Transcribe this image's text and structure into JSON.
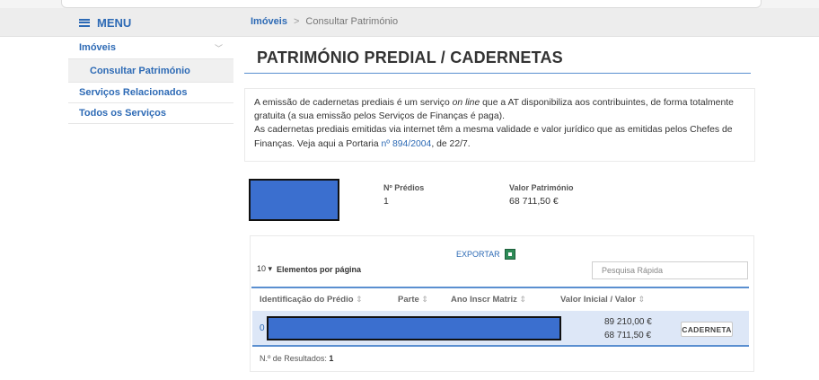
{
  "menu": {
    "label": "MENU",
    "icon": "hamburger-icon"
  },
  "breadcrumb": {
    "root": "Imóveis",
    "separator": ">",
    "current": "Consultar Património"
  },
  "sidebar": {
    "items": [
      {
        "label": "Imóveis",
        "expanded": true
      },
      {
        "label": "Consultar Património",
        "sub": true
      },
      {
        "label": "Serviços Relacionados"
      },
      {
        "label": "Todos os Serviços"
      }
    ]
  },
  "page": {
    "title": "PATRIMÓNIO PREDIAL / CADERNETAS"
  },
  "info": {
    "p1_a": "A emissão de cadernetas prediais é um serviço ",
    "p1_em": "on line",
    "p1_b": " que a AT disponibiliza aos contribuintes, de forma totalmente gratuita (a sua emissão pelos Serviços de Finanças é paga).",
    "p2_a": "As cadernetas prediais emitidas via internet têm a mesma validade e valor jurídico que as emitidas pelos Chefes de Finanças. Veja aqui a Portaria ",
    "p2_link": "nº 894/2004",
    "p2_b": ", de 22/7."
  },
  "summary": {
    "predios_label": "Nº Prédios",
    "predios_value": "1",
    "valor_label": "Valor Património",
    "valor_value": "68 711,50 €"
  },
  "table": {
    "export_label": "EXPORTAR",
    "page_size": "10",
    "page_size_label": "Elementos por página",
    "search_placeholder": "Pesquisa Rápida",
    "headers": [
      "Identificação do Prédio",
      "Parte",
      "Ano Inscr Matriz",
      "Valor Inicial / Valor"
    ],
    "rows": [
      {
        "id_visible": "0",
        "valor_inicial": "89 210,00 €",
        "valor": "68 711,50 €",
        "action": "CADERNETA"
      }
    ],
    "results_label": "N.º de Resultados:",
    "results_count": "1"
  },
  "colors": {
    "accent": "#2d6ab5",
    "rule": "#5a8fd0",
    "row_highlight": "#dde7f7",
    "redaction": "#3b6fcf"
  }
}
